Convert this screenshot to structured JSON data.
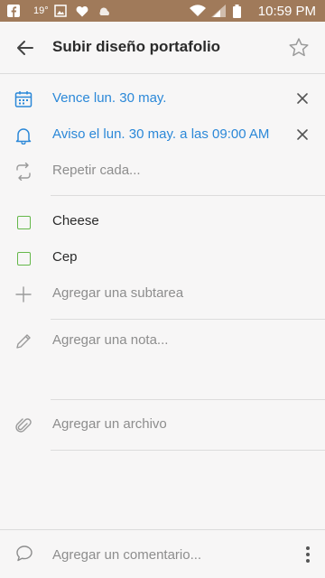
{
  "status_bar": {
    "temperature": "19°",
    "time": "10:59 PM",
    "left_icons": [
      "facebook-icon",
      "image-icon",
      "heart-icon",
      "weather-icon"
    ],
    "right_icons": [
      "wifi-icon",
      "signal-icon",
      "battery-icon"
    ]
  },
  "header": {
    "title": "Subir diseño portafolio",
    "back_icon": "arrow-left-icon",
    "star_icon": "star-icon"
  },
  "due_date": {
    "label": "Vence lun. 30 may."
  },
  "reminder": {
    "label": "Aviso el lun. 30 may. a las 09:00 AM"
  },
  "repeat": {
    "placeholder": "Repetir cada..."
  },
  "subtasks": [
    {
      "label": "Cheese",
      "checked": false
    },
    {
      "label": "Cep",
      "checked": false
    }
  ],
  "add_subtask": {
    "placeholder": "Agregar una subtarea"
  },
  "note": {
    "placeholder": "Agregar una nota..."
  },
  "file": {
    "placeholder": "Agregar un archivo"
  },
  "comment": {
    "placeholder": "Agregar un comentario..."
  },
  "colors": {
    "status_bar": "#a07a5a",
    "accent_blue": "#2b88d8",
    "checkbox_green": "#65b84a",
    "background": "#f7f6f6"
  }
}
